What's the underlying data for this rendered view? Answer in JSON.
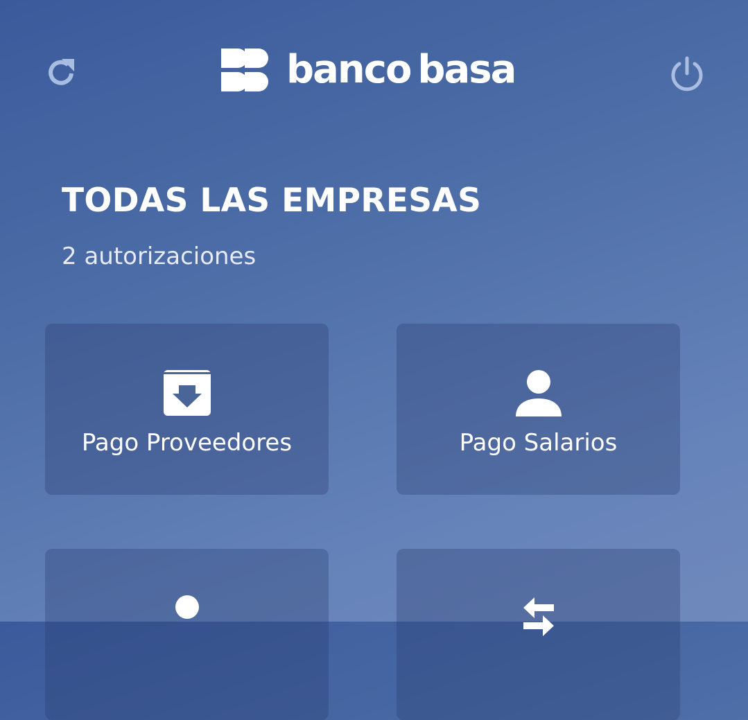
{
  "header": {
    "brand_part1": "banco",
    "brand_part2": "basa",
    "refresh_icon": "refresh-icon",
    "power_icon": "power-icon"
  },
  "summary": {
    "title": "TODAS LAS EMPRESAS",
    "subtitle": "2 autorizaciones"
  },
  "tiles": [
    {
      "label": "Pago Proveedores",
      "icon": "archive-download-icon"
    },
    {
      "label": "Pago Salarios",
      "icon": "person-icon"
    },
    {
      "label": "",
      "icon": "circle-icon"
    },
    {
      "label": "",
      "icon": "transfer-arrows-icon"
    }
  ],
  "colors": {
    "bg_top": "#3a5a9b",
    "bg_bottom": "#7089bc",
    "icon_faded": "#a9bde3",
    "tile": "#3c5690"
  }
}
